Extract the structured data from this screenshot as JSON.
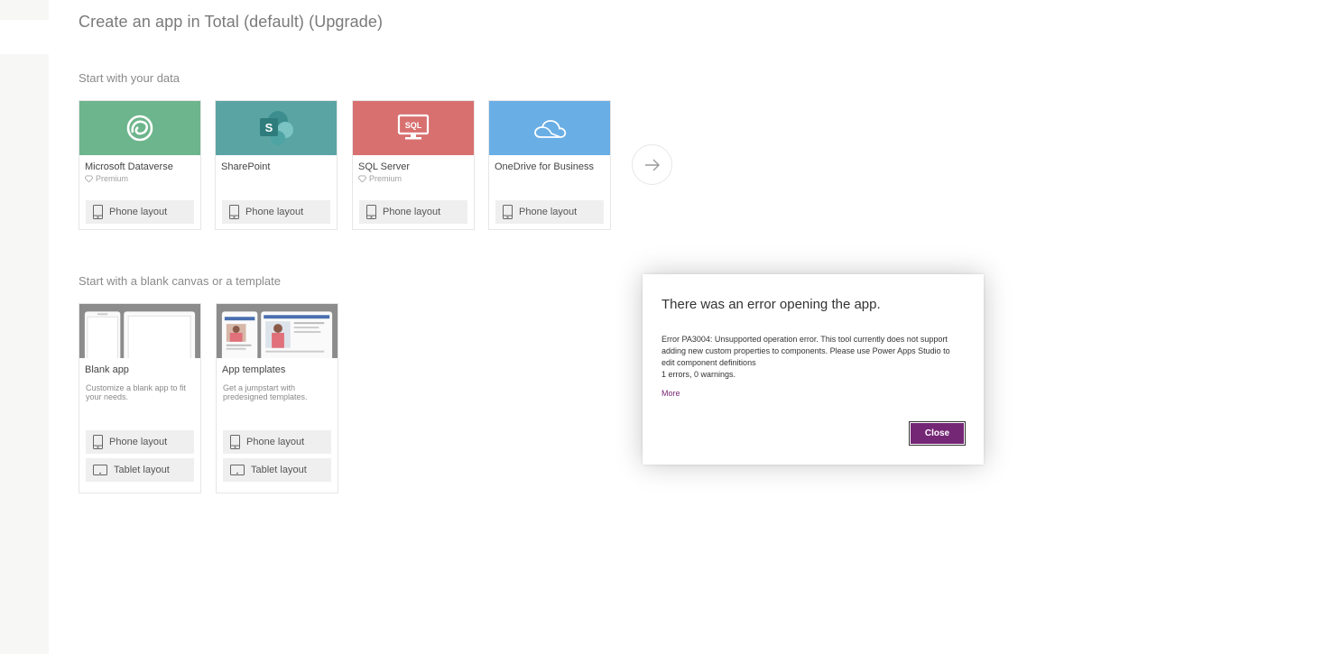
{
  "page": {
    "title": "Create an app in Total (default) (Upgrade)"
  },
  "sections": {
    "data": "Start with your data",
    "templates": "Start with a blank canvas or a template"
  },
  "data_sources": [
    {
      "name": "Microsoft Dataverse",
      "premium": "Premium",
      "color": "#6db58c",
      "icon": "dataverse-icon",
      "layout": "Phone layout"
    },
    {
      "name": "SharePoint",
      "premium": "",
      "color": "#5ba4a4",
      "icon": "sharepoint-icon",
      "layout": "Phone layout"
    },
    {
      "name": "SQL Server",
      "premium": "Premium",
      "color": "#d87070",
      "icon": "sql-server-icon",
      "sql_text": "SQL",
      "layout": "Phone layout"
    },
    {
      "name": "OneDrive for Business",
      "premium": "",
      "color": "#6aaee6",
      "icon": "onedrive-icon",
      "layout": "Phone layout"
    }
  ],
  "sharepoint_letter": "S",
  "templates": [
    {
      "name": "Blank app",
      "desc": "Customize a blank app to fit your needs.",
      "phone": "Phone layout",
      "tablet": "Tablet layout"
    },
    {
      "name": "App templates",
      "desc": "Get a jumpstart with predesigned templates.",
      "phone": "Phone layout",
      "tablet": "Tablet layout"
    }
  ],
  "dialog": {
    "title": "There was an error opening the app.",
    "message": "Error PA3004: Unsupported operation error. This tool currently does not support adding new custom properties to components. Please use Power Apps Studio to edit component definitions",
    "summary": "1 errors, 0 warnings.",
    "more": "More",
    "close": "Close",
    "accent": "#742774"
  }
}
